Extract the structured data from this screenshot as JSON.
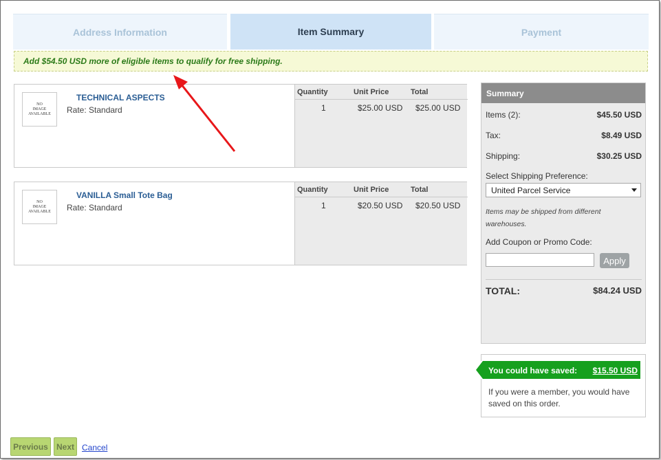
{
  "tabs": [
    {
      "label": "Address Information"
    },
    {
      "label": "Item Summary"
    },
    {
      "label": "Payment"
    }
  ],
  "banner": {
    "text": "Add $54.50 USD more of eligible items to qualify for free shipping."
  },
  "grid_headers": {
    "quantity": "Quantity",
    "unit_price": "Unit Price",
    "total": "Total"
  },
  "items": [
    {
      "thumb_text": [
        "NO",
        "IMAGE",
        "AVAILABLE"
      ],
      "name": "TECHNICAL ASPECTS",
      "rate": "Rate: Standard",
      "quantity": "1",
      "unit_price": "$25.00 USD",
      "total": "$25.00 USD"
    },
    {
      "thumb_text": [
        "NO",
        "IMAGE",
        "AVAILABLE"
      ],
      "name": "VANILLA Small Tote Bag",
      "rate": "Rate: Standard",
      "quantity": "1",
      "unit_price": "$20.50 USD",
      "total": "$20.50 USD"
    }
  ],
  "summary": {
    "title": "Summary",
    "items_label": "Items (2):",
    "items_value": "$45.50 USD",
    "tax_label": "Tax:",
    "tax_value": "$8.49 USD",
    "shipping_label": "Shipping:",
    "shipping_value": "$30.25 USD",
    "shipping_pref_label": "Select Shipping Preference:",
    "shipping_pref_value": "United Parcel Service",
    "note": "Items may be shipped from different warehouses.",
    "coupon_label": "Add Coupon or Promo Code:",
    "coupon_value": "",
    "apply_label": "Apply",
    "total_label": "TOTAL:",
    "total_value": "$84.24 USD"
  },
  "savings": {
    "label": "You could have saved:",
    "amount": "$15.50 USD",
    "text": "If you were a member, you would have saved on this order."
  },
  "nav": {
    "previous": "Previous",
    "next": "Next",
    "cancel": "Cancel"
  },
  "colors": {
    "accent_green": "#16a01e",
    "link_blue": "#2a5d94",
    "banner_text": "#2b7a18",
    "arrow_red": "#e8171a"
  }
}
